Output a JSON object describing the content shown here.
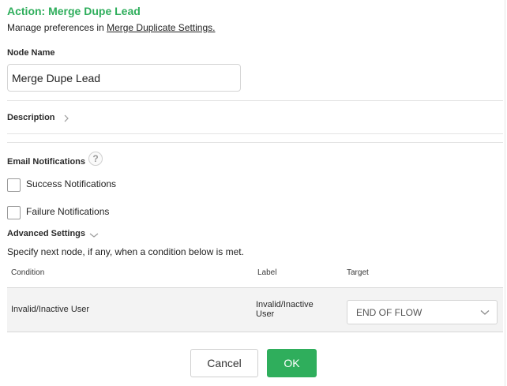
{
  "header": {
    "title": "Action: Merge Dupe Lead",
    "subtitle_prefix": "Manage preferences in ",
    "subtitle_link": "Merge Duplicate Settings."
  },
  "node_name": {
    "label": "Node Name",
    "value": "Merge Dupe Lead"
  },
  "description": {
    "label": "Description",
    "expand_icon": "chevron-right-icon"
  },
  "email_notifications": {
    "label": "Email Notifications",
    "help_icon": "question-mark-icon",
    "help_glyph": "?",
    "success_label": "Success Notifications",
    "success_checked": false,
    "failure_label": "Failure Notifications",
    "failure_checked": false
  },
  "advanced_settings": {
    "label": "Advanced Settings",
    "toggle_icon": "chevron-down-icon",
    "instruction": "Specify next node, if any, when a condition below is met.",
    "columns": {
      "condition": "Condition",
      "label": "Label",
      "target": "Target"
    },
    "rows": [
      {
        "condition": "Invalid/Inactive User",
        "label": "Invalid/Inactive User",
        "target": "END OF FLOW"
      }
    ]
  },
  "footer": {
    "cancel_label": "Cancel",
    "ok_label": "OK"
  },
  "colors": {
    "accent": "#2fae5c",
    "row_background": "#f3f3f3"
  }
}
